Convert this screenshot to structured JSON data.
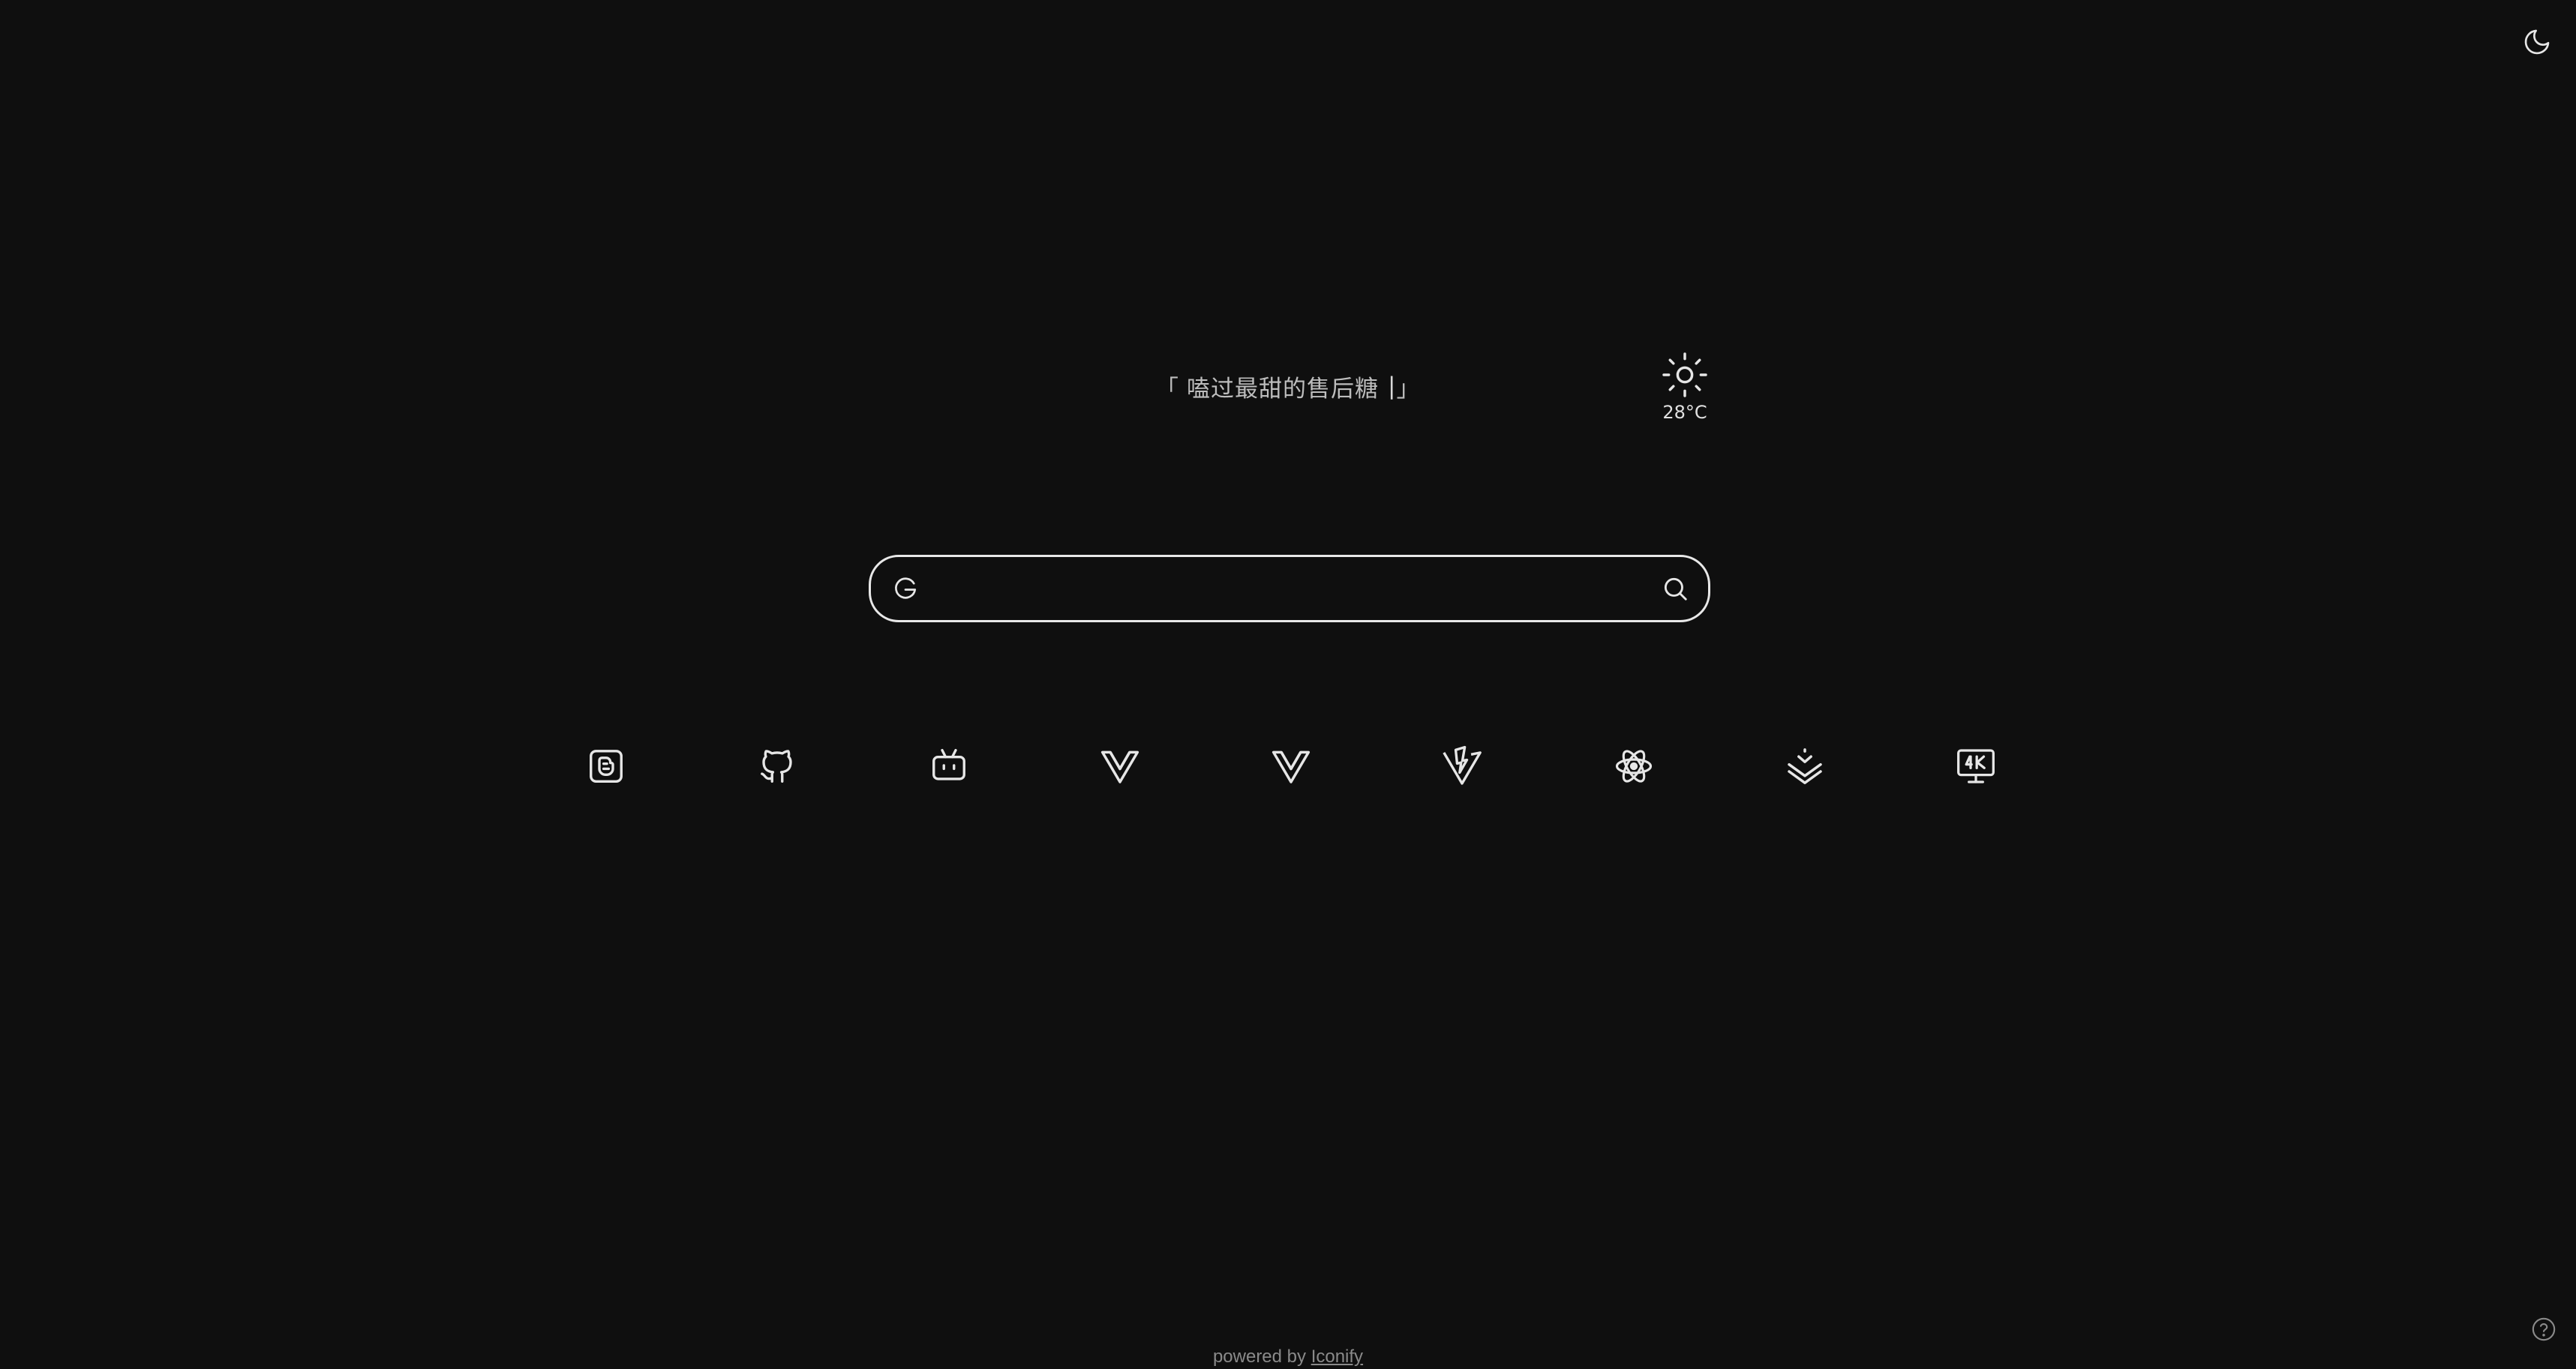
{
  "quote": {
    "open": "「",
    "text": "嗑过最甜的售后糖",
    "caret": "|",
    "close": "」"
  },
  "weather": {
    "icon": "sun-icon",
    "temperature": "28°C"
  },
  "search": {
    "engine_icon": "google-icon",
    "value": "",
    "placeholder": ""
  },
  "shortcuts": [
    {
      "icon": "blogger-icon"
    },
    {
      "icon": "github-icon"
    },
    {
      "icon": "bilibili-icon"
    },
    {
      "icon": "vue-icon"
    },
    {
      "icon": "vuetify-icon"
    },
    {
      "icon": "vite-icon"
    },
    {
      "icon": "react-icon"
    },
    {
      "icon": "download-icon"
    },
    {
      "icon": "4k-monitor-icon"
    }
  ],
  "footer": {
    "prefix": "powered by",
    "link": "Iconify"
  },
  "colors": {
    "background": "#0f0f0f",
    "foreground": "#e6e6e6",
    "muted": "#8a8a8a"
  }
}
